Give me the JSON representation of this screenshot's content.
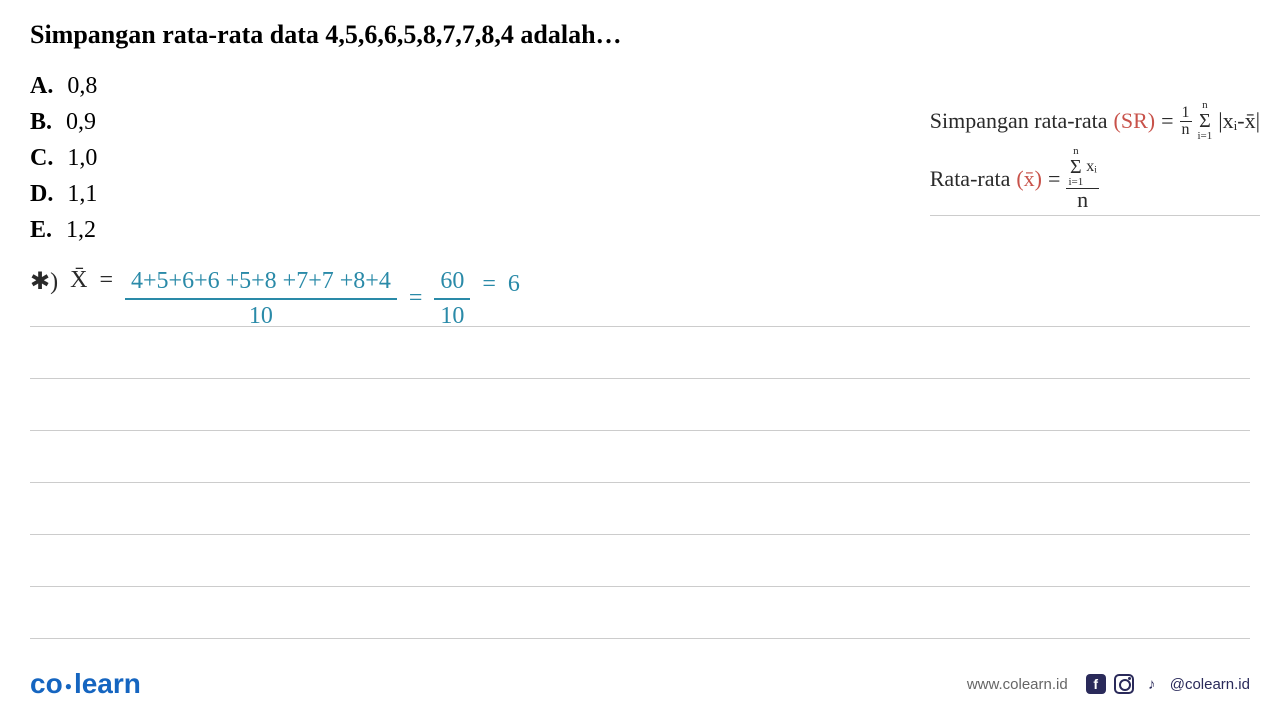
{
  "question": "Simpangan rata-rata data 4,5,6,6,5,8,7,7,8,4 adalah…",
  "options": [
    {
      "letter": "A.",
      "value": "0,8"
    },
    {
      "letter": "B.",
      "value": "0,9"
    },
    {
      "letter": "C.",
      "value": "1,0"
    },
    {
      "letter": "D.",
      "value": "1,1"
    },
    {
      "letter": "E.",
      "value": "1,2"
    }
  ],
  "formulas": {
    "sr_label": "Simpangan rata-rata",
    "sr_symbol": "(SR)",
    "mean_label": "Rata-rata",
    "mean_symbol": "(x̄)",
    "eq": "=",
    "one": "1",
    "n": "n",
    "sigma_top": "n",
    "sigma_bot": "i=1",
    "sigma_sym": "Σ",
    "abs_expr": "|xᵢ-x̄|",
    "xi": "xᵢ"
  },
  "calculation": {
    "marker": "✱)",
    "xbar": "X̄",
    "eq": "=",
    "numerator": "4+5+6+6 +5+8 +7+7 +8+4",
    "denom": "10",
    "mid_num": "60",
    "mid_den": "10",
    "result": "6"
  },
  "footer": {
    "logo_left": "co",
    "logo_right": "learn",
    "url": "www.colearn.id",
    "handle": "@colearn.id"
  }
}
